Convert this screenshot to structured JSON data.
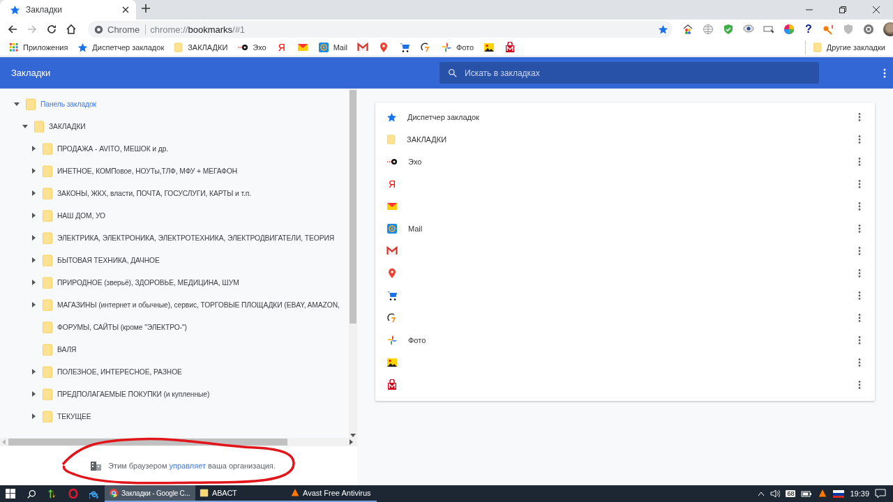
{
  "tab": {
    "title": "Закладки",
    "selected": true
  },
  "address": {
    "origin": "Chrome",
    "scheme": "chrome://",
    "host": "bookmarks",
    "rest": "/#1"
  },
  "extensions_help": "?",
  "bookmarks_bar": {
    "items": [
      {
        "kind": "apps",
        "label": "Приложения"
      },
      {
        "kind": "star",
        "label": "Диспетчер закладок"
      },
      {
        "kind": "folder",
        "label": "ЗАКЛАДКИ"
      },
      {
        "kind": "echo",
        "label": "Эхо"
      },
      {
        "kind": "yandex",
        "glyph": "Я"
      },
      {
        "kind": "envelope"
      },
      {
        "kind": "at",
        "label": "Mail"
      },
      {
        "kind": "gmail"
      },
      {
        "kind": "pin"
      },
      {
        "kind": "cart"
      },
      {
        "kind": "swirl"
      },
      {
        "kind": "photos",
        "label": "Фото"
      },
      {
        "kind": "image"
      },
      {
        "kind": "bag"
      }
    ],
    "other": "Другие закладки"
  },
  "app": {
    "title": "Закладки",
    "search_placeholder": "Искать в закладках"
  },
  "tree": {
    "title": "Панель закладок",
    "expanded": true,
    "selected": true,
    "children": [
      {
        "title": "ЗАКЛАДКИ",
        "expanded": true,
        "selected": false,
        "children": [
          {
            "title": "ПРОДАЖА - AVITO, МЕШОК и др.",
            "expanded": false,
            "selected": false
          },
          {
            "title": "ИНЕТНОЕ, КОМПовое, НОУТы,ТЛФ, МФУ + МЕГАФОН",
            "expanded": false,
            "selected": false
          },
          {
            "title": "ЗАКОНЫ, ЖКХ, власти, ПОЧТА, ГОСУСЛУГИ, КАРТЫ и т.п.",
            "expanded": false,
            "selected": false
          },
          {
            "title": "НАШ ДОМ, УО",
            "expanded": false,
            "selected": false
          },
          {
            "title": "ЭЛЕКТРИКА, ЭЛЕКТРОНИКА, ЭЛЕКТРОТЕХНИКА, ЭЛЕКТРОДВИГАТЕЛИ, ТЕОРИЯ",
            "expanded": false,
            "selected": false
          },
          {
            "title": "БЫТОВАЯ ТЕХНИКА, ДАЧНОЕ",
            "expanded": false,
            "selected": false
          },
          {
            "title": "ПРИРОДНОЕ (зверьё), ЗДОРОВЬЕ, МЕДИЦИНА, ШУМ",
            "expanded": false,
            "selected": false
          },
          {
            "title": "МАГАЗИНЫ (интернет и обычные), сервис, ТОРГОВЫЕ ПЛОЩАДКИ (EBAY, AMAZON,",
            "expanded": false,
            "selected": false
          },
          {
            "title": "ФОРУМЫ, САЙТЫ (кроме \"ЭЛЕКТРО-\")",
            "selected": false
          },
          {
            "title": "ВАЛЯ",
            "selected": false
          },
          {
            "title": "ПОЛЕЗНОЕ, ИНТЕРЕСНОЕ, РАЗНОЕ",
            "expanded": false,
            "selected": false
          },
          {
            "title": "ПРЕДПОЛАГАЕМЫЕ ПОКУПКИ (и купленные)",
            "expanded": false,
            "selected": false
          },
          {
            "title": "ТЕКУЩЕЕ",
            "expanded": false,
            "selected": false
          }
        ]
      }
    ]
  },
  "list": [
    {
      "kind": "star",
      "label": "Диспетчер закладок"
    },
    {
      "kind": "folder",
      "label": "ЗАКЛАДКИ"
    },
    {
      "kind": "echo",
      "label": "Эхо"
    },
    {
      "kind": "yandex",
      "glyph": "Я"
    },
    {
      "kind": "envelope"
    },
    {
      "kind": "at",
      "label": "Mail"
    },
    {
      "kind": "gmail"
    },
    {
      "kind": "pin"
    },
    {
      "kind": "cart"
    },
    {
      "kind": "swirl"
    },
    {
      "kind": "photos",
      "label": "Фото"
    },
    {
      "kind": "image"
    },
    {
      "kind": "bag"
    }
  ],
  "footer": {
    "before": "Этим браузером",
    "link": "управляет",
    "after": "ваша организация."
  },
  "taskbar": {
    "windows": [
      {
        "kind": "chrome",
        "title": "Закладки - Google C...",
        "selected": true
      },
      {
        "kind": "folder",
        "title": "АВАСТ",
        "selected": false
      },
      {
        "kind": "avast",
        "title": "Avast Free Antivirus",
        "selected": false
      }
    ],
    "tray_badge": "68",
    "clock": "19:39"
  }
}
